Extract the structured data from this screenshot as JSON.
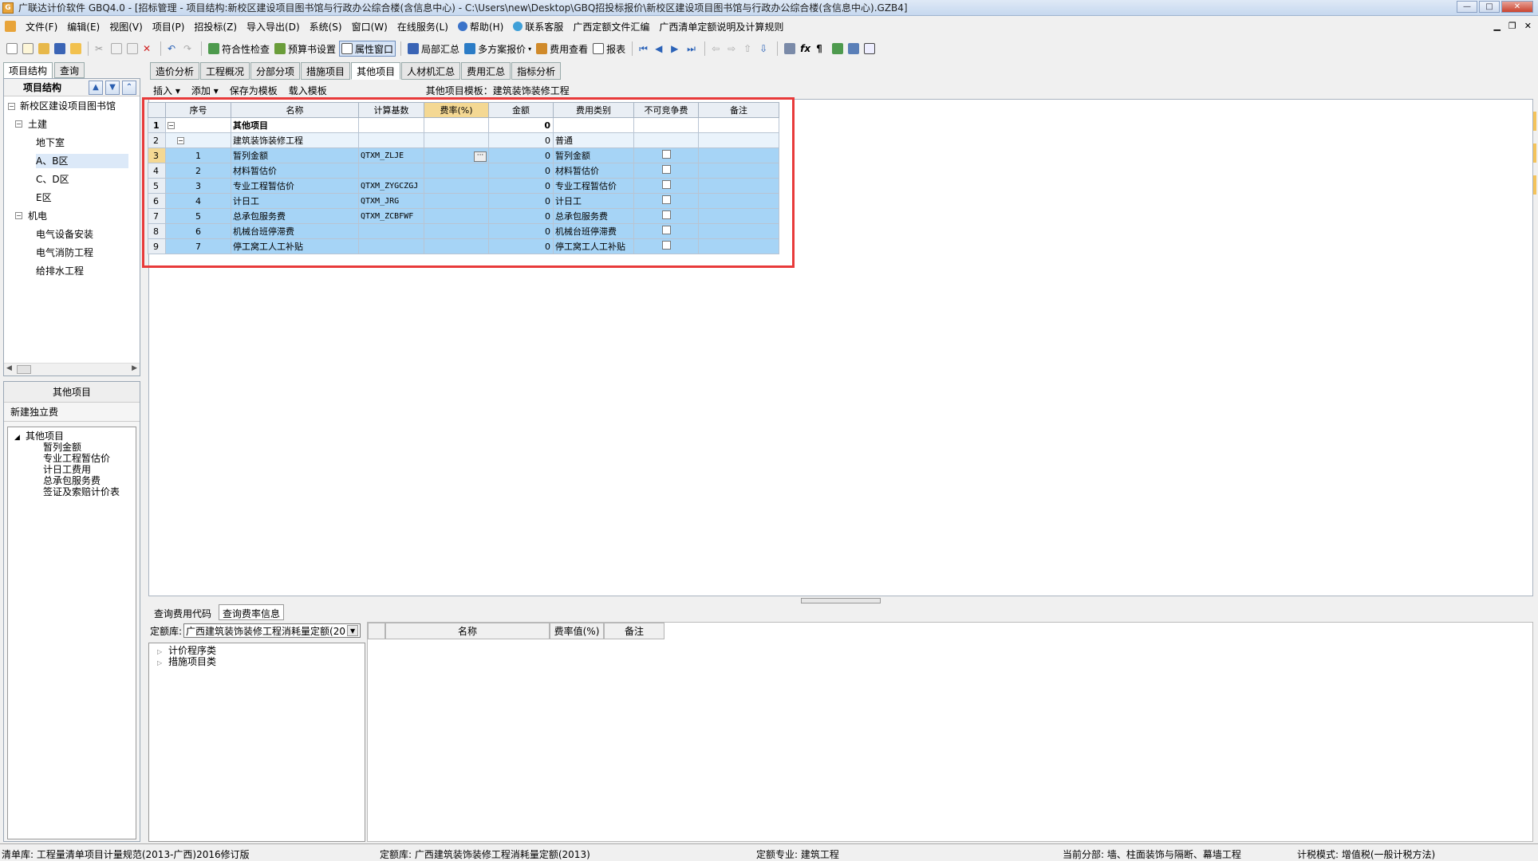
{
  "title": "广联达计价软件 GBQ4.0 - [招标管理 - 项目结构:新校区建设项目图书馆与行政办公综合楼(含信息中心) - C:\\Users\\new\\Desktop\\GBQ招投标报价\\新校区建设项目图书馆与行政办公综合楼(含信息中心).GZB4]",
  "menu": [
    "文件(F)",
    "编辑(E)",
    "视图(V)",
    "项目(P)",
    "招投标(Z)",
    "导入导出(D)",
    "系统(S)",
    "窗口(W)",
    "在线服务(L)",
    "帮助(H)",
    "联系客服",
    "广西定额文件汇编",
    "广西清单定额说明及计算规则"
  ],
  "toolbar": {
    "compliance": "符合性检查",
    "budget_settings": "预算书设置",
    "property_window": "属性窗口",
    "local_summary": "局部汇总",
    "multi_quote": "多方案报价",
    "fee_view": "费用查看",
    "report": "报表"
  },
  "left": {
    "tabs": [
      "项目结构",
      "查询"
    ],
    "header": "项目结构",
    "tree": [
      "新校区建设项目图书馆",
      "土建",
      "地下室",
      "A、B区",
      "C、D区",
      "E区",
      "机电",
      "电气设备安装",
      "电气消防工程",
      "给排水工程"
    ],
    "lower_title": "其他项目",
    "lower_sub": "新建独立费",
    "lower_tree": [
      "其他项目",
      "暂列金额",
      "专业工程暂估价",
      "计日工费用",
      "总承包服务费",
      "签证及索赔计价表"
    ]
  },
  "tabs": [
    "造价分析",
    "工程概况",
    "分部分项",
    "措施项目",
    "其他项目",
    "人材机汇总",
    "费用汇总",
    "指标分析"
  ],
  "sub": {
    "insert": "插入",
    "add": "添加",
    "save_template": "保存为模板",
    "load_template": "载入模板",
    "template_label": "其他项目模板：建筑装饰装修工程"
  },
  "grid": {
    "headers": [
      "序号",
      "名称",
      "计算基数",
      "费率(%)",
      "金额",
      "费用类别",
      "不可竞争费",
      "备注"
    ],
    "rows": [
      {
        "n": "1",
        "seq": "",
        "name": "其他项目",
        "base": "",
        "amount": "0",
        "cat": ""
      },
      {
        "n": "2",
        "seq": "",
        "name": "建筑装饰装修工程",
        "base": "",
        "amount": "0",
        "cat": "普通"
      },
      {
        "n": "3",
        "seq": "1",
        "name": "暂列金额",
        "base": "QTXM_ZLJE",
        "amount": "0",
        "cat": "暂列金额"
      },
      {
        "n": "4",
        "seq": "2",
        "name": "材料暂估价",
        "base": "",
        "amount": "0",
        "cat": "材料暂估价"
      },
      {
        "n": "5",
        "seq": "3",
        "name": "专业工程暂估价",
        "base": "QTXM_ZYGCZGJ",
        "amount": "0",
        "cat": "专业工程暂估价"
      },
      {
        "n": "6",
        "seq": "4",
        "name": "计日工",
        "base": "QTXM_JRG",
        "amount": "0",
        "cat": "计日工"
      },
      {
        "n": "7",
        "seq": "5",
        "name": "总承包服务费",
        "base": "QTXM_ZCBFWF",
        "amount": "0",
        "cat": "总承包服务费"
      },
      {
        "n": "8",
        "seq": "6",
        "name": "机械台班停滞费",
        "base": "",
        "amount": "0",
        "cat": "机械台班停滞费"
      },
      {
        "n": "9",
        "seq": "7",
        "name": "停工窝工人工补贴",
        "base": "",
        "amount": "0",
        "cat": "停工窝工人工补贴"
      }
    ]
  },
  "bottom": {
    "tabs": [
      "查询费用代码",
      "查询费率信息"
    ],
    "quota_label": "定额库:",
    "quota_value": "广西建筑装饰装修工程消耗量定额(20",
    "qtree": [
      "计价程序类",
      "措施项目类"
    ],
    "qheaders": [
      "名称",
      "费率值(%)",
      "备注"
    ]
  },
  "status": {
    "list_lib": "清单库:  工程量清单项目计量规范(2013-广西)2016修订版",
    "quota_lib": "定额库:  广西建筑装饰装修工程消耗量定额(2013)",
    "quota_major": "定额专业:  建筑工程",
    "current_part": "当前分部:  墙、柱面装饰与隔断、幕墙工程",
    "tax_mode": "计税模式:  增值税(一般计税方法)"
  },
  "colors": {
    "highlight_row": "#a6d4f6",
    "red_frame": "#e83a3a",
    "rate_header": "#f4d893"
  }
}
